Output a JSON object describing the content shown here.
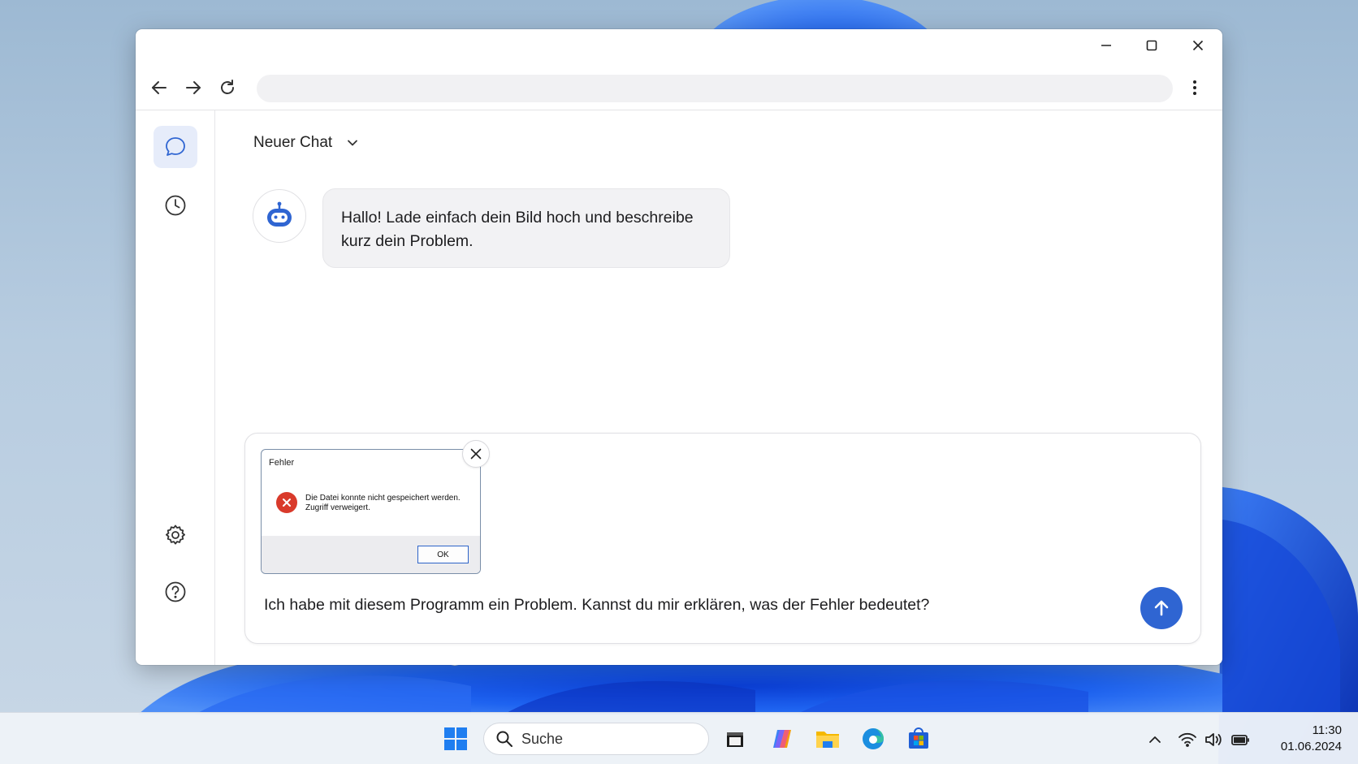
{
  "browser": {
    "address_value": "",
    "address_placeholder": ""
  },
  "chat": {
    "title": "Neuer Chat",
    "bot_message": "Hallo! Lade einfach dein Bild hoch und beschreibe kurz dein Problem."
  },
  "attachment": {
    "dialog_title": "Fehler",
    "dialog_message_line1": "Die Datei konnte nicht gespeichert werden.",
    "dialog_message_line2": "Zugriff verweigert.",
    "dialog_ok": "OK"
  },
  "composer": {
    "prompt_value": "Ich habe mit diesem Programm ein Problem. Kannst du mir erklären, was der Fehler bedeutet?"
  },
  "taskbar": {
    "search_label": "Suche",
    "time": "11:30",
    "date": "01.06.2024"
  },
  "colors": {
    "accent": "#2f65d2",
    "sidebar_active_bg": "#e6ecfa",
    "error_red": "#d93a2b"
  },
  "icons": {
    "sidebar": [
      "chat-icon",
      "history-clock-icon",
      "settings-gear-icon",
      "help-question-icon"
    ],
    "taskbar": [
      "windows-start-icon",
      "search-icon",
      "task-view-icon",
      "copilot-icon",
      "file-explorer-icon",
      "edge-browser-icon",
      "store-icon"
    ],
    "tray": [
      "chevron-up-icon",
      "wifi-icon",
      "volume-icon",
      "battery-icon"
    ]
  }
}
